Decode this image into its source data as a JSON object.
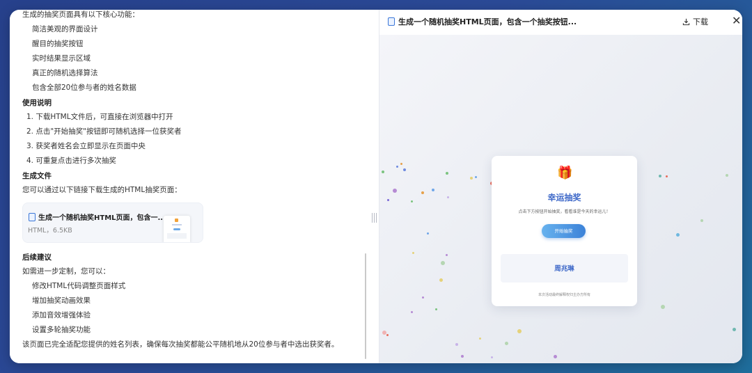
{
  "chat": {
    "intro": "生成的抽奖页面具有以下核心功能：",
    "features": [
      "简洁美观的界面设计",
      "醒目的抽奖按钮",
      "实时结果显示区域",
      "真正的随机选择算法",
      "包含全部20位参与者的姓名数据"
    ],
    "usage_heading": "使用说明",
    "usage_steps": [
      "1. 下载HTML文件后，可直接在浏览器中打开",
      "2. 点击\"开始抽奖\"按钮即可随机选择一位获奖者",
      "3. 获奖者姓名会立即显示在页面中央",
      "4. 可重复点击进行多次抽奖"
    ],
    "file_heading": "生成文件",
    "file_intro": "您可以通过以下链接下载生成的HTML抽奖页面：",
    "file_card": {
      "title": "生成一个随机抽奖HTML页面，包含一...",
      "meta": "HTML，6.5KB"
    },
    "next_heading": "后续建议",
    "next_intro": "如需进一步定制，您可以：",
    "next_items": [
      "修改HTML代码调整页面样式",
      "增加抽奖动画效果",
      "添加音效增强体验",
      "设置多轮抽奖功能"
    ],
    "closing": "该页面已完全适配您提供的姓名列表，确保每次抽奖都能公平随机地从20位参与者中选出获奖者。"
  },
  "preview": {
    "title": "生成一个随机抽奖HTML页面，包含一个抽奖按钮...",
    "download_label": "下载",
    "close_icon": "close-icon",
    "card": {
      "gift_icon": "🎁",
      "title": "幸运抽奖",
      "subtitle": "点击下方按钮开始抽奖，看看谁是今天的幸运儿！",
      "button_label": "开始抽奖",
      "result": "周兆琳",
      "footer": "本次活动最终解释权归主办方所有"
    }
  },
  "colors": {
    "accent": "#3c67c8",
    "button_start": "#67b2ee",
    "button_end": "#3c82d8"
  }
}
